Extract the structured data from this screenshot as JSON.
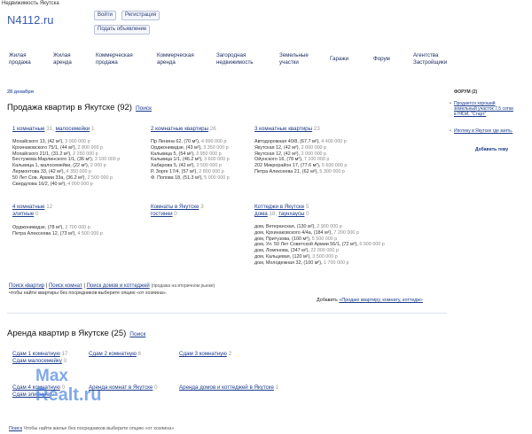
{
  "top_note": "Недвижимость Якутска",
  "logo": "N4112.ru",
  "auth": {
    "login": "Войти",
    "register": "Регистрация",
    "post": "Подать объявление"
  },
  "nav": [
    {
      "l1": "Жилая",
      "l2": "продажа"
    },
    {
      "l1": "Жилая",
      "l2": "аренда"
    },
    {
      "l1": "Коммерческая",
      "l2": "продажа"
    },
    {
      "l1": "Коммерческая",
      "l2": "аренда"
    },
    {
      "l1": "Загородная",
      "l2": "недвижимость"
    },
    {
      "l1": "Земельные",
      "l2": "участки"
    },
    {
      "l1": "Гаражи",
      "l2": ""
    },
    {
      "l1": "Форум",
      "l2": ""
    },
    {
      "l1": "Агентства",
      "l2": "Застройщики"
    }
  ],
  "date": "28 декабря",
  "sale": {
    "title": "Продажа квартир в Якутске (92)",
    "search": "Поиск",
    "one": {
      "label": "1 комнатные",
      "count": "31,",
      "label2": "малосемейки",
      "count2": "1",
      "items": [
        {
          "a": "Мохайского 13, (42 м²),",
          "p": "3 000 000 р"
        },
        {
          "a": "Крхинаковского 75/1, (44 м²),",
          "p": "2 800 000 р"
        },
        {
          "a": "Мохайского 21/1, (31.2 м²),",
          "p": "2 250 000 р"
        },
        {
          "a": "Бестужева-Марлинского 1/1, (36 м²),",
          "p": "3 100 000 р"
        },
        {
          "a": "Кальвица 1, малосемейки, (22 м²),",
          "p": "2 000 р"
        },
        {
          "a": "Лермонтова 33, (42 м²),",
          "p": "4 350 000 р"
        },
        {
          "a": "50 Лет Сов. Армии 33а, (36.2 м²),",
          "p": "2 500 000 р"
        },
        {
          "a": "Свердлова 16/2, (40 м²),",
          "p": "4 000 000 р"
        }
      ]
    },
    "two": {
      "label": "2 комнатные квартиры",
      "count": "26",
      "items": [
        {
          "a": "Пр Ленина 62, (70 м²),",
          "p": "4 990 000 р"
        },
        {
          "a": "Орджоникидзе, (43 м²),",
          "p": "3 350 000 р"
        },
        {
          "a": "Кальвица 5, (54 м²),",
          "p": "3 950 000 р"
        },
        {
          "a": "Кальвица 1/1, (46.2 м²),",
          "p": "3 600 000 р"
        },
        {
          "a": "Хабарова 5, (42 м²),",
          "p": "3 500 000 р"
        },
        {
          "a": "Р. Зорге 17/4, (57 м²),",
          "p": "2 800 000 р"
        },
        {
          "a": "Ф. Попова 18, (51.3 м²),",
          "p": "5 000 000 р"
        }
      ]
    },
    "three": {
      "label": "3 комнатные квартиры",
      "count": "23",
      "items": [
        {
          "a": "Автодорожная 40/8, (67.7 м²),",
          "p": "4 400 000 р"
        },
        {
          "a": "Якутская 12, (42 м²),",
          "p": "2 000 000 р"
        },
        {
          "a": "Якутская 12, (42 м²),",
          "p": "2 000 000 р"
        },
        {
          "a": "Ойунского 16, (78 м²),",
          "p": "7 100 000 р"
        },
        {
          "a": "202 Микрорайон 17, (77.6 м²),",
          "p": "5 600 000 р"
        },
        {
          "a": "Петра Алексеева 21, (62 м²),",
          "p": "5 300 000 р"
        }
      ]
    },
    "four": {
      "label": "4 комнатные",
      "count": "12",
      "label2": "элитные",
      "count2": "0",
      "items": [
        {
          "a": "Орджоникидзе, (78 м²),",
          "p": "2 700 000 р"
        },
        {
          "a": "Петра Алексеева 12, (73 м²),",
          "p": "4 500 000 р"
        }
      ]
    },
    "rooms": {
      "label": "Комнаты в Якутске",
      "count": "3",
      "label2": "гостинки",
      "count2": "0"
    },
    "cottages": {
      "label": "Коттеджи в Якутске",
      "count": "5",
      "label2": "дома",
      "count2": "18,",
      "label3": "таунхаусы",
      "count3": "0",
      "items": [
        {
          "a": "дом, Ветеранская, (130 м²),",
          "p": "2 900 000 р"
        },
        {
          "a": "дом, Крхинаковского 4/4а, (184 м²),",
          "p": "7 200 000 р"
        },
        {
          "a": "дом, Притузова, (100 м²),",
          "p": "5 500 000 р"
        },
        {
          "a": "дом, Ул. 50 Лет Советской Армии 56/1, (72 м²),",
          "p": "6 900 000 р"
        },
        {
          "a": "дом, Ломпнова, (347 м²),",
          "p": "22 000 000 р"
        },
        {
          "a": "дом, Кальцевая, (120 м²),",
          "p": "3 500 000 р"
        },
        {
          "a": "дом, Молодежная 32, (100 м²),",
          "p": "1 700 000 р"
        }
      ]
    },
    "search_links": {
      "a": "Поиск квартир",
      "b": "Поиск комнат",
      "c": "Поиск домов и коттеджей"
    },
    "search_note": "(продажа на вторичном рынке)",
    "hint": "чтобы найти квартиры без посредников выберите опцию «от хозяина».",
    "add_prefix": "Добавить",
    "add_link": "«Продаю квартиру, комнату, коттедж»"
  },
  "rent": {
    "title": "Аренда квартир в Якутске (25)",
    "search": "Поиск",
    "r1": {
      "label": "Сдам 1 комнатную",
      "count": "17"
    },
    "r1b": {
      "label": "Сдам малосемейку",
      "count": "0"
    },
    "r2": {
      "label": "Сдам 2 комнатную",
      "count": "6"
    },
    "r3": {
      "label": "Сдам 3 комнатную",
      "count": "2"
    },
    "r4": {
      "label": "Сдам 4 комнатную",
      "count": "0"
    },
    "r4b": {
      "label": "Сдам элитные",
      "count": "0"
    },
    "r5": {
      "label": "Аренда комнат в Якутске",
      "count": "0"
    },
    "r6": {
      "label": "Аренда домов и коттеджей в Якутске",
      "count": "1"
    },
    "bottom_link": "Поиск",
    "bottom_note": "Чтобы найти жилье без посредников выберите опцию «от хозяина»"
  },
  "sidebar": {
    "title": "ФОРУМ (2)",
    "items": [
      {
        "text": "Продается хороший земельный участок 7,5 сотки в НЮИ, \"Старт\""
      },
      {
        "text": "Ипотеку в Якутске где взять."
      }
    ],
    "more": "Добавить тему"
  },
  "watermark": {
    "line1": "Max",
    "line2": "Realt.ru"
  },
  "colors": {
    "link": "#1a3a8a",
    "logo": "#3a5ab0",
    "watermark": "#3e7be0"
  }
}
